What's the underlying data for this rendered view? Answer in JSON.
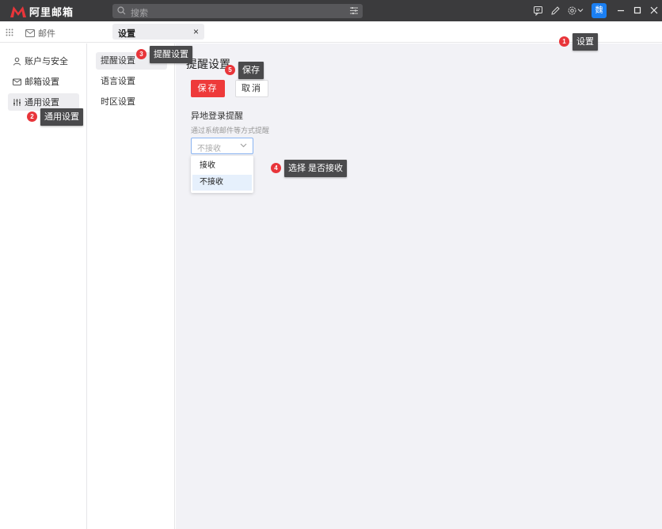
{
  "titlebar": {
    "app_name": "阿里邮箱",
    "search_placeholder": "搜索",
    "avatar_text": "魏"
  },
  "tabs": {
    "mail_label": "邮件",
    "settings_label": "设置",
    "close_glyph": "×"
  },
  "sidebar": {
    "items": [
      {
        "label": "账户与安全",
        "icon": "user-icon"
      },
      {
        "label": "邮箱设置",
        "icon": "mailbox-icon"
      },
      {
        "label": "通用设置",
        "icon": "sliders-icon"
      }
    ]
  },
  "submenu": {
    "items": [
      {
        "label": "提醒设置"
      },
      {
        "label": "语言设置"
      },
      {
        "label": "时区设置"
      }
    ]
  },
  "main": {
    "title": "提醒设置",
    "save_label": "保存",
    "cancel_label": "取消",
    "section_title": "异地登录提醒",
    "section_desc": "通过系统邮件等方式提醒",
    "select_value": "不接收",
    "options": [
      "接收",
      "不接收"
    ]
  },
  "annotations": [
    {
      "num": "1",
      "text": "设置"
    },
    {
      "num": "2",
      "text": "通用设置"
    },
    {
      "num": "3",
      "text": "提醒设置"
    },
    {
      "num": "4",
      "text": "选择 是否接收"
    },
    {
      "num": "5",
      "text": "保存"
    }
  ],
  "colors": {
    "brand_red": "#e8353a",
    "titlebar_bg": "#3b3b3d",
    "avatar_blue": "#1b7ff2"
  }
}
